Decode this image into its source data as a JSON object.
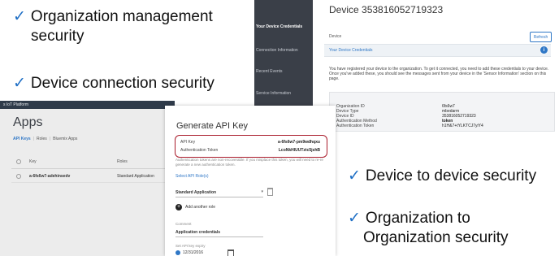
{
  "bullets": {
    "check": "✓",
    "org_mgmt_line1": "Organization management",
    "org_mgmt_line2": "security",
    "device_conn": "Device connection security",
    "device_to_device": "Device to device security",
    "org_to_org_line1": "Organization to",
    "org_to_org_line2": "Organization security"
  },
  "device_panel": {
    "title": "Device 353816052719323",
    "sidebar": [
      {
        "label": "Your Device Credentials",
        "active": true
      },
      {
        "label": "Connection Information",
        "active": false
      },
      {
        "label": "Recent Events",
        "active": false
      },
      {
        "label": "Service Information",
        "active": false
      }
    ],
    "device_label": "Device",
    "refresh_label": "Refresh",
    "credentials_heading": "Your Device Credentials",
    "info_icon": "info-icon",
    "description": "You have registered your device to the organization. To get it connected, you need to add these credentials to your device. Once you've added these, you should see the messages sent from your device in the 'Sensor Information' section on this page.",
    "credentials": [
      {
        "key": "Organization ID",
        "value": "6fs6w7"
      },
      {
        "key": "Device Type",
        "value": "mbedarm"
      },
      {
        "key": "Device ID",
        "value": "353816052719323"
      },
      {
        "key": "Authentication Method",
        "value": "token"
      },
      {
        "key": "Authentication Token",
        "value": "h1H&7+tYLKTCJ7yiY4"
      }
    ]
  },
  "apps_panel": {
    "platform": "s IoT Platform",
    "title": "Apps",
    "tabs": [
      "API Keys",
      "Roles",
      "Bluemix Apps"
    ],
    "columns": [
      "Key",
      "Roles"
    ],
    "rows": [
      {
        "key": "a-6fs6w7-adehinsedv",
        "role": "Standard Application"
      }
    ]
  },
  "modal": {
    "title": "Generate API Key",
    "api_key_label": "API Key",
    "api_key_value": "a-6fs6w7-pm9wdhqxu",
    "auth_token_label": "Authentication Token",
    "auth_token_value": "LcoNkHIUUTztc5jshB",
    "note": "Authentication tokens are non-recoverable. If you misplace this token, you will need to re-re generate a new authentication token.",
    "select_role": "Select API Role(s)",
    "role": "Standard Application",
    "add_role": "Add another role",
    "comment_label": "Comment",
    "comment_value": "Application credentials",
    "expiry_label": "Set API key expiry",
    "expiry_value": "12/31/2016"
  },
  "colors": {
    "check": "#1f6fc5",
    "accent": "#2f77c6",
    "highlight_border": "#a91b2b",
    "sidebar": "#3a3f48"
  }
}
